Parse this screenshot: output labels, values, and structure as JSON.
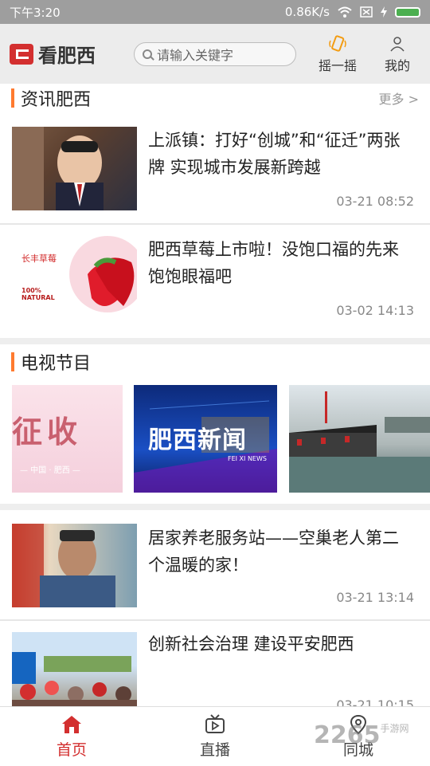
{
  "status": {
    "time": "下午3:20",
    "speed": "0.86K/s"
  },
  "appbar": {
    "logo": "看肥西",
    "search_placeholder": "请输入关键字",
    "shake_label": "摇一摇",
    "mine_label": "我的"
  },
  "news_section": {
    "title": "资讯肥西",
    "more": "更多 >"
  },
  "news": [
    {
      "title": "上派镇：打好“创城”和“征迁”两张牌  实现城市发展新跨越",
      "time": "03-21 08:52"
    },
    {
      "title": "肥西草莓上市啦！没饱口福的先来饱饱眼福吧",
      "time": "03-02 14:13",
      "thumb_text": "长丰草莓",
      "thumb_sub": "100% NATURAL"
    }
  ],
  "tv_section": {
    "title": "电视节目"
  },
  "tv_cards": [
    {
      "text": "征收",
      "sub": "— 中国 · 肥西 —"
    },
    {
      "text": "肥西新闻",
      "sub": "FEI XI NEWS"
    },
    {
      "text": ""
    }
  ],
  "news2": [
    {
      "title": "居家养老服务站——空巢老人第二个温暖的家！",
      "time": "03-21 13:14"
    },
    {
      "title": "创新社会治理 建设平安肥西",
      "time": "03-21 10:15"
    }
  ],
  "bottomnav": [
    {
      "label": "首页",
      "icon": "home-icon",
      "active": true
    },
    {
      "label": "直播",
      "icon": "tv-play-icon",
      "active": false
    },
    {
      "label": "同城",
      "icon": "location-icon",
      "active": false
    }
  ],
  "watermark": {
    "text": "2265",
    "sub": "手游网"
  },
  "colors": {
    "accent": "#d32f2f",
    "section_bar": "#ff7a2f"
  }
}
